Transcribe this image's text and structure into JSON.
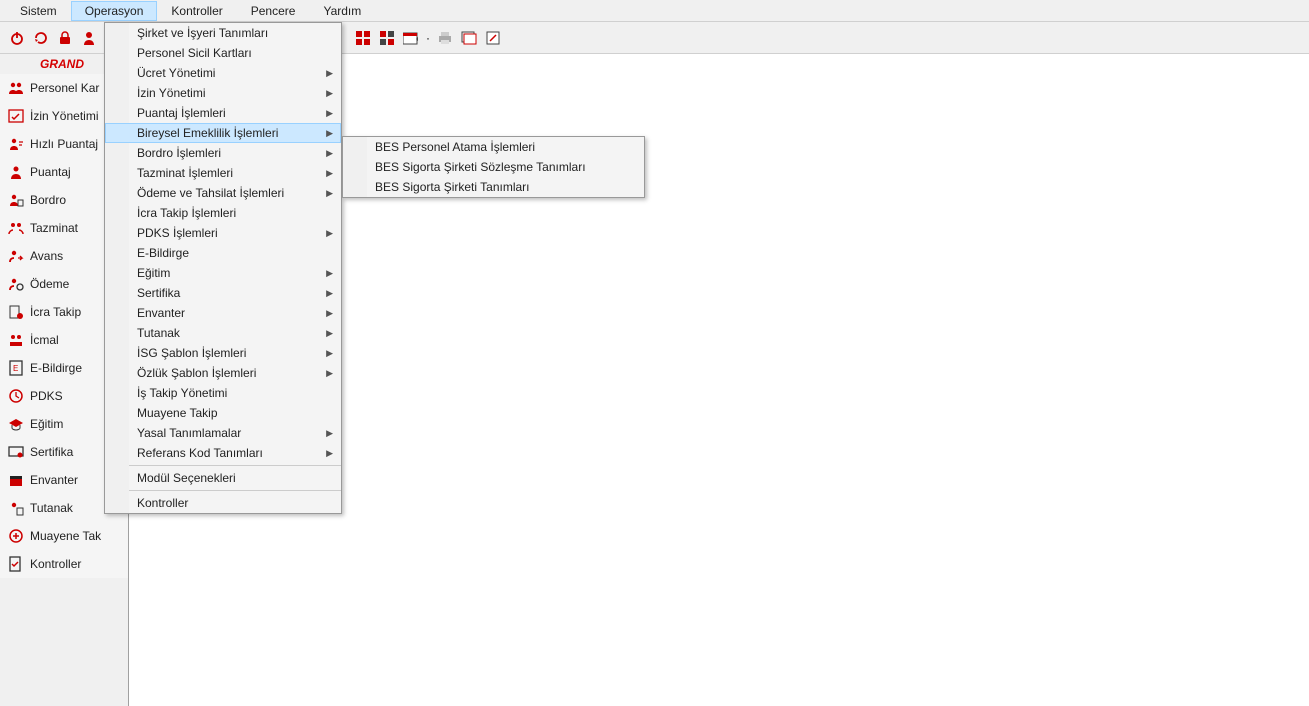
{
  "menubar": {
    "items": [
      {
        "label": "Sistem"
      },
      {
        "label": "Operasyon"
      },
      {
        "label": "Kontroller"
      },
      {
        "label": "Pencere"
      },
      {
        "label": "Yardım"
      }
    ]
  },
  "brand": "GRAND",
  "sidebar": {
    "items": [
      {
        "label": "Personel Kar"
      },
      {
        "label": "İzin Yönetimi"
      },
      {
        "label": "Hızlı Puantaj"
      },
      {
        "label": "Puantaj"
      },
      {
        "label": "Bordro"
      },
      {
        "label": "Tazminat"
      },
      {
        "label": "Avans"
      },
      {
        "label": "Ödeme"
      },
      {
        "label": "İcra Takip"
      },
      {
        "label": "İcmal"
      },
      {
        "label": "E-Bildirge"
      },
      {
        "label": "PDKS"
      },
      {
        "label": "Eğitim"
      },
      {
        "label": "Sertifika"
      },
      {
        "label": "Envanter"
      },
      {
        "label": "Tutanak"
      },
      {
        "label": "Muayene Tak"
      },
      {
        "label": "Kontroller"
      }
    ]
  },
  "dropdown": {
    "items": [
      {
        "label": "Şirket ve İşyeri Tanımları",
        "arrow": false
      },
      {
        "label": "Personel Sicil Kartları",
        "arrow": false
      },
      {
        "label": "Ücret Yönetimi",
        "arrow": true
      },
      {
        "label": "İzin Yönetimi",
        "arrow": true
      },
      {
        "label": "Puantaj İşlemleri",
        "arrow": true
      },
      {
        "label": "Bireysel Emeklilik İşlemleri",
        "arrow": true,
        "hl": true
      },
      {
        "label": "Bordro İşlemleri",
        "arrow": true
      },
      {
        "label": "Tazminat İşlemleri",
        "arrow": true
      },
      {
        "label": "Ödeme ve Tahsilat İşlemleri",
        "arrow": true
      },
      {
        "label": "İcra Takip İşlemleri",
        "arrow": false
      },
      {
        "label": "PDKS İşlemleri",
        "arrow": true
      },
      {
        "label": "E-Bildirge",
        "arrow": false
      },
      {
        "label": "Eğitim",
        "arrow": true
      },
      {
        "label": "Sertifika",
        "arrow": true
      },
      {
        "label": "Envanter",
        "arrow": true
      },
      {
        "label": "Tutanak",
        "arrow": true
      },
      {
        "label": "İSG Şablon İşlemleri",
        "arrow": true
      },
      {
        "label": "Özlük Şablon İşlemleri",
        "arrow": true
      },
      {
        "label": "İş Takip Yönetimi",
        "arrow": false
      },
      {
        "label": "Muayene Takip",
        "arrow": false
      },
      {
        "label": "Yasal Tanımlamalar",
        "arrow": true
      },
      {
        "label": "Referans Kod Tanımları",
        "arrow": true
      },
      {
        "sep": true
      },
      {
        "label": "Modül Seçenekleri",
        "arrow": false
      },
      {
        "sep": true
      },
      {
        "label": "Kontroller",
        "arrow": false
      }
    ]
  },
  "submenu": {
    "items": [
      {
        "label": "BES Personel Atama İşlemleri"
      },
      {
        "label": "BES Sigorta Şirketi Sözleşme Tanımları"
      },
      {
        "label": "BES Sigorta Şirketi Tanımları"
      }
    ]
  }
}
